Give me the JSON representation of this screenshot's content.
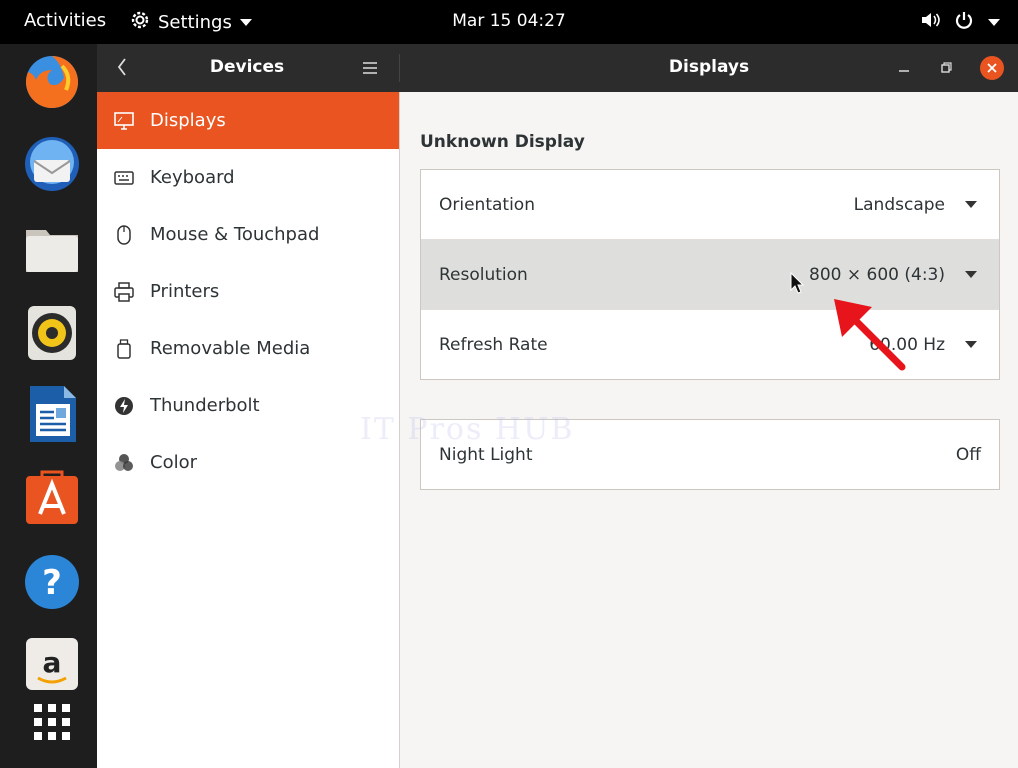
{
  "topbar": {
    "activities": "Activities",
    "app_menu": "Settings",
    "clock": "Mar 15  04:27"
  },
  "dock": {
    "apps": [
      "firefox-icon",
      "thunderbird-icon",
      "files-icon",
      "rhythmbox-icon",
      "libreoffice-writer-icon",
      "ubuntu-software-icon",
      "help-icon",
      "amazon-icon",
      "show-applications-icon"
    ]
  },
  "window": {
    "sidebar_title": "Devices",
    "main_title": "Displays"
  },
  "sidebar": {
    "items": [
      {
        "label": "Displays",
        "icon": "display-icon"
      },
      {
        "label": "Keyboard",
        "icon": "keyboard-icon"
      },
      {
        "label": "Mouse & Touchpad",
        "icon": "mouse-icon"
      },
      {
        "label": "Printers",
        "icon": "printer-icon"
      },
      {
        "label": "Removable Media",
        "icon": "removable-media-icon"
      },
      {
        "label": "Thunderbolt",
        "icon": "thunderbolt-icon"
      },
      {
        "label": "Color",
        "icon": "color-icon"
      }
    ]
  },
  "main": {
    "display_name": "Unknown Display",
    "orientation": {
      "label": "Orientation",
      "value": "Landscape"
    },
    "resolution": {
      "label": "Resolution",
      "value": "800 × 600 (4:3)"
    },
    "refresh_rate": {
      "label": "Refresh Rate",
      "value": "60.00 Hz"
    },
    "night_light": {
      "label": "Night Light",
      "value": "Off"
    }
  },
  "overlay": {
    "watermark": "IT Pros HUB"
  },
  "colors": {
    "accent": "#e95420",
    "headerbar": "#2c2c2c",
    "dock": "#1e1e1e",
    "annotation_arrow": "#e8141c"
  }
}
